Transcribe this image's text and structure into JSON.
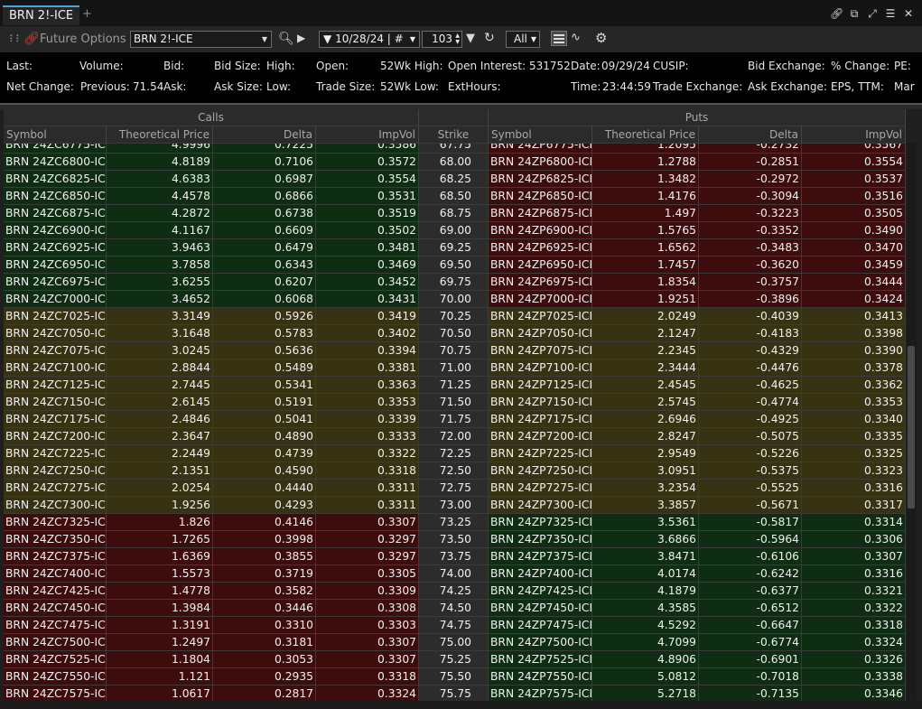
{
  "tab": {
    "title": "BRN 2!-ICE",
    "add": "+"
  },
  "toolbar": {
    "module_title": "Future Options",
    "symbol": "BRN 2!-ICE",
    "expiry_filter": "10/28/24 | #",
    "strikes_count": "103",
    "type_filter": "All",
    "icons": [
      "grip-icon",
      "link-icon",
      "search-icon",
      "play-icon",
      "filter-icon",
      "refresh-icon",
      "grid-view-icon",
      "wave-icon",
      "gear-icon",
      "link-chain-icon",
      "popout-icon",
      "expand-icon",
      "menu-icon",
      "close-icon"
    ]
  },
  "quote": {
    "line1": [
      {
        "label": "Last:",
        "value": ""
      },
      {
        "label": "Volume:",
        "value": ""
      },
      {
        "label": "Bid:",
        "value": ""
      },
      {
        "label": "Bid Size:",
        "value": ""
      },
      {
        "label": "High:",
        "value": ""
      },
      {
        "label": "Open:",
        "value": ""
      },
      {
        "label": "52Wk High:",
        "value": ""
      },
      {
        "label": "Open Interest:",
        "value": "531752"
      },
      {
        "label": "Date:",
        "value": "09/29/24"
      },
      {
        "label": "CUSIP:",
        "value": ""
      },
      {
        "label": "Bid Exchange:",
        "value": ""
      },
      {
        "label": "% Change:",
        "value": ""
      },
      {
        "label": "PE:",
        "value": ""
      }
    ],
    "line2": [
      {
        "label": "Net Change:",
        "value": ""
      },
      {
        "label": "Previous:",
        "value": "71.54"
      },
      {
        "label": "Ask:",
        "value": ""
      },
      {
        "label": "Ask Size:",
        "value": ""
      },
      {
        "label": "Low:",
        "value": ""
      },
      {
        "label": "Trade Size:",
        "value": ""
      },
      {
        "label": "52Wk Low:",
        "value": ""
      },
      {
        "label": "ExtHours:",
        "value": ""
      },
      {
        "label": "Time:",
        "value": "23:44:59"
      },
      {
        "label": "Trade Exchange:",
        "value": ""
      },
      {
        "label": "Ask Exchange:",
        "value": ""
      },
      {
        "label": "EPS, TTM:",
        "value": ""
      },
      {
        "label": "Mar",
        "value": ""
      }
    ]
  },
  "grid": {
    "group_headers": {
      "calls": "Calls",
      "puts": "Puts"
    },
    "columns": {
      "call_symbol": "Symbol",
      "call_theo": "Theoretical Price",
      "call_delta": "Delta",
      "call_iv": "ImpVol",
      "strike": "Strike",
      "put_symbol": "Symbol",
      "put_theo": "Theoretical Price",
      "put_delta": "Delta",
      "put_iv": "ImpVol"
    },
    "colors": {
      "itm_green": "#0f2d12",
      "itm_red": "#3d0d0d",
      "atm_olive": "#363212"
    },
    "rows": [
      {
        "cs": "BRN 24ZC6775-ICE",
        "ct": "4.9996",
        "cd": "0.7225",
        "ci": "0.3586",
        "k": "67.75",
        "ps": "BRN 24ZP6775-ICE",
        "pt": "1.2095",
        "pd": "-0.2732",
        "pi": "0.3567",
        "cc": "green",
        "pc": "red"
      },
      {
        "cs": "BRN 24ZC6800-ICE",
        "ct": "4.8189",
        "cd": "0.7106",
        "ci": "0.3572",
        "k": "68.00",
        "ps": "BRN 24ZP6800-ICE",
        "pt": "1.2788",
        "pd": "-0.2851",
        "pi": "0.3554",
        "cc": "green",
        "pc": "red"
      },
      {
        "cs": "BRN 24ZC6825-ICE",
        "ct": "4.6383",
        "cd": "0.6987",
        "ci": "0.3554",
        "k": "68.25",
        "ps": "BRN 24ZP6825-ICE",
        "pt": "1.3482",
        "pd": "-0.2972",
        "pi": "0.3537",
        "cc": "green",
        "pc": "red"
      },
      {
        "cs": "BRN 24ZC6850-ICE",
        "ct": "4.4578",
        "cd": "0.6866",
        "ci": "0.3531",
        "k": "68.50",
        "ps": "BRN 24ZP6850-ICE",
        "pt": "1.4176",
        "pd": "-0.3094",
        "pi": "0.3516",
        "cc": "green",
        "pc": "red"
      },
      {
        "cs": "BRN 24ZC6875-ICE",
        "ct": "4.2872",
        "cd": "0.6738",
        "ci": "0.3519",
        "k": "68.75",
        "ps": "BRN 24ZP6875-ICE",
        "pt": "1.497",
        "pd": "-0.3223",
        "pi": "0.3505",
        "cc": "green",
        "pc": "red"
      },
      {
        "cs": "BRN 24ZC6900-ICE",
        "ct": "4.1167",
        "cd": "0.6609",
        "ci": "0.3502",
        "k": "69.00",
        "ps": "BRN 24ZP6900-ICE",
        "pt": "1.5765",
        "pd": "-0.3352",
        "pi": "0.3490",
        "cc": "green",
        "pc": "red"
      },
      {
        "cs": "BRN 24ZC6925-ICE",
        "ct": "3.9463",
        "cd": "0.6479",
        "ci": "0.3481",
        "k": "69.25",
        "ps": "BRN 24ZP6925-ICE",
        "pt": "1.6562",
        "pd": "-0.3483",
        "pi": "0.3470",
        "cc": "green",
        "pc": "red"
      },
      {
        "cs": "BRN 24ZC6950-ICE",
        "ct": "3.7858",
        "cd": "0.6343",
        "ci": "0.3469",
        "k": "69.50",
        "ps": "BRN 24ZP6950-ICE",
        "pt": "1.7457",
        "pd": "-0.3620",
        "pi": "0.3459",
        "cc": "green",
        "pc": "red"
      },
      {
        "cs": "BRN 24ZC6975-ICE",
        "ct": "3.6255",
        "cd": "0.6207",
        "ci": "0.3452",
        "k": "69.75",
        "ps": "BRN 24ZP6975-ICE",
        "pt": "1.8354",
        "pd": "-0.3757",
        "pi": "0.3444",
        "cc": "green",
        "pc": "red"
      },
      {
        "cs": "BRN 24ZC7000-ICE",
        "ct": "3.4652",
        "cd": "0.6068",
        "ci": "0.3431",
        "k": "70.00",
        "ps": "BRN 24ZP7000-ICE",
        "pt": "1.9251",
        "pd": "-0.3896",
        "pi": "0.3424",
        "cc": "green",
        "pc": "red"
      },
      {
        "cs": "BRN 24ZC7025-ICE",
        "ct": "3.3149",
        "cd": "0.5926",
        "ci": "0.3419",
        "k": "70.25",
        "ps": "BRN 24ZP7025-ICE",
        "pt": "2.0249",
        "pd": "-0.4039",
        "pi": "0.3413",
        "cc": "olive",
        "pc": "olive"
      },
      {
        "cs": "BRN 24ZC7050-ICE",
        "ct": "3.1648",
        "cd": "0.5783",
        "ci": "0.3402",
        "k": "70.50",
        "ps": "BRN 24ZP7050-ICE",
        "pt": "2.1247",
        "pd": "-0.4183",
        "pi": "0.3398",
        "cc": "olive",
        "pc": "olive"
      },
      {
        "cs": "BRN 24ZC7075-ICE",
        "ct": "3.0245",
        "cd": "0.5636",
        "ci": "0.3394",
        "k": "70.75",
        "ps": "BRN 24ZP7075-ICE",
        "pt": "2.2345",
        "pd": "-0.4329",
        "pi": "0.3390",
        "cc": "olive",
        "pc": "olive"
      },
      {
        "cs": "BRN 24ZC7100-ICE",
        "ct": "2.8844",
        "cd": "0.5489",
        "ci": "0.3381",
        "k": "71.00",
        "ps": "BRN 24ZP7100-ICE",
        "pt": "2.3444",
        "pd": "-0.4476",
        "pi": "0.3378",
        "cc": "olive",
        "pc": "olive"
      },
      {
        "cs": "BRN 24ZC7125-ICE",
        "ct": "2.7445",
        "cd": "0.5341",
        "ci": "0.3363",
        "k": "71.25",
        "ps": "BRN 24ZP7125-ICE",
        "pt": "2.4545",
        "pd": "-0.4625",
        "pi": "0.3362",
        "cc": "olive",
        "pc": "olive"
      },
      {
        "cs": "BRN 24ZC7150-ICE",
        "ct": "2.6145",
        "cd": "0.5191",
        "ci": "0.3353",
        "k": "71.50",
        "ps": "BRN 24ZP7150-ICE",
        "pt": "2.5745",
        "pd": "-0.4774",
        "pi": "0.3353",
        "cc": "olive",
        "pc": "olive"
      },
      {
        "cs": "BRN 24ZC7175-ICE",
        "ct": "2.4846",
        "cd": "0.5041",
        "ci": "0.3339",
        "k": "71.75",
        "ps": "BRN 24ZP7175-ICE",
        "pt": "2.6946",
        "pd": "-0.4925",
        "pi": "0.3340",
        "cc": "olive",
        "pc": "olive"
      },
      {
        "cs": "BRN 24ZC7200-ICE",
        "ct": "2.3647",
        "cd": "0.4890",
        "ci": "0.3333",
        "k": "72.00",
        "ps": "BRN 24ZP7200-ICE",
        "pt": "2.8247",
        "pd": "-0.5075",
        "pi": "0.3335",
        "cc": "olive",
        "pc": "olive"
      },
      {
        "cs": "BRN 24ZC7225-ICE",
        "ct": "2.2449",
        "cd": "0.4739",
        "ci": "0.3322",
        "k": "72.25",
        "ps": "BRN 24ZP7225-ICE",
        "pt": "2.9549",
        "pd": "-0.5226",
        "pi": "0.3325",
        "cc": "olive",
        "pc": "olive"
      },
      {
        "cs": "BRN 24ZC7250-ICE",
        "ct": "2.1351",
        "cd": "0.4590",
        "ci": "0.3318",
        "k": "72.50",
        "ps": "BRN 24ZP7250-ICE",
        "pt": "3.0951",
        "pd": "-0.5375",
        "pi": "0.3323",
        "cc": "olive",
        "pc": "olive"
      },
      {
        "cs": "BRN 24ZC7275-ICE",
        "ct": "2.0254",
        "cd": "0.4440",
        "ci": "0.3311",
        "k": "72.75",
        "ps": "BRN 24ZP7275-ICE",
        "pt": "3.2354",
        "pd": "-0.5525",
        "pi": "0.3316",
        "cc": "olive",
        "pc": "olive"
      },
      {
        "cs": "BRN 24ZC7300-ICE",
        "ct": "1.9256",
        "cd": "0.4293",
        "ci": "0.3311",
        "k": "73.00",
        "ps": "BRN 24ZP7300-ICE",
        "pt": "3.3857",
        "pd": "-0.5671",
        "pi": "0.3317",
        "cc": "olive",
        "pc": "olive"
      },
      {
        "cs": "BRN 24ZC7325-ICE",
        "ct": "1.826",
        "cd": "0.4146",
        "ci": "0.3307",
        "k": "73.25",
        "ps": "BRN 24ZP7325-ICE",
        "pt": "3.5361",
        "pd": "-0.5817",
        "pi": "0.3314",
        "cc": "red",
        "pc": "green"
      },
      {
        "cs": "BRN 24ZC7350-ICE",
        "ct": "1.7265",
        "cd": "0.3998",
        "ci": "0.3297",
        "k": "73.50",
        "ps": "BRN 24ZP7350-ICE",
        "pt": "3.6866",
        "pd": "-0.5964",
        "pi": "0.3306",
        "cc": "red",
        "pc": "green"
      },
      {
        "cs": "BRN 24ZC7375-ICE",
        "ct": "1.6369",
        "cd": "0.3855",
        "ci": "0.3297",
        "k": "73.75",
        "ps": "BRN 24ZP7375-ICE",
        "pt": "3.8471",
        "pd": "-0.6106",
        "pi": "0.3307",
        "cc": "red",
        "pc": "green"
      },
      {
        "cs": "BRN 24ZC7400-ICE",
        "ct": "1.5573",
        "cd": "0.3719",
        "ci": "0.3305",
        "k": "74.00",
        "ps": "BRN 24ZP7400-ICE",
        "pt": "4.0174",
        "pd": "-0.6242",
        "pi": "0.3316",
        "cc": "red",
        "pc": "green"
      },
      {
        "cs": "BRN 24ZC7425-ICE",
        "ct": "1.4778",
        "cd": "0.3582",
        "ci": "0.3309",
        "k": "74.25",
        "ps": "BRN 24ZP7425-ICE",
        "pt": "4.1879",
        "pd": "-0.6377",
        "pi": "0.3321",
        "cc": "red",
        "pc": "green"
      },
      {
        "cs": "BRN 24ZC7450-ICE",
        "ct": "1.3984",
        "cd": "0.3446",
        "ci": "0.3308",
        "k": "74.50",
        "ps": "BRN 24ZP7450-ICE",
        "pt": "4.3585",
        "pd": "-0.6512",
        "pi": "0.3322",
        "cc": "red",
        "pc": "green"
      },
      {
        "cs": "BRN 24ZC7475-ICE",
        "ct": "1.3191",
        "cd": "0.3310",
        "ci": "0.3303",
        "k": "74.75",
        "ps": "BRN 24ZP7475-ICE",
        "pt": "4.5292",
        "pd": "-0.6647",
        "pi": "0.3318",
        "cc": "red",
        "pc": "green"
      },
      {
        "cs": "BRN 24ZC7500-ICE",
        "ct": "1.2497",
        "cd": "0.3181",
        "ci": "0.3307",
        "k": "75.00",
        "ps": "BRN 24ZP7500-ICE",
        "pt": "4.7099",
        "pd": "-0.6774",
        "pi": "0.3324",
        "cc": "red",
        "pc": "green"
      },
      {
        "cs": "BRN 24ZC7525-ICE",
        "ct": "1.1804",
        "cd": "0.3053",
        "ci": "0.3307",
        "k": "75.25",
        "ps": "BRN 24ZP7525-ICE",
        "pt": "4.8906",
        "pd": "-0.6901",
        "pi": "0.3326",
        "cc": "red",
        "pc": "green"
      },
      {
        "cs": "BRN 24ZC7550-ICE",
        "ct": "1.121",
        "cd": "0.2935",
        "ci": "0.3318",
        "k": "75.50",
        "ps": "BRN 24ZP7550-ICE",
        "pt": "5.0812",
        "pd": "-0.7018",
        "pi": "0.3338",
        "cc": "red",
        "pc": "green"
      },
      {
        "cs": "BRN 24ZC7575-ICE",
        "ct": "1.0617",
        "cd": "0.2817",
        "ci": "0.3324",
        "k": "75.75",
        "ps": "BRN 24ZP7575-ICE",
        "pt": "5.2718",
        "pd": "-0.7135",
        "pi": "0.3346",
        "cc": "red",
        "pc": "green"
      }
    ]
  }
}
